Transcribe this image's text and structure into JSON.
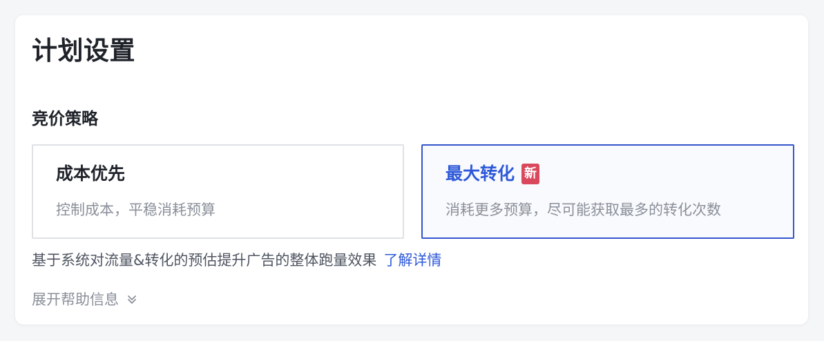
{
  "page": {
    "title": "计划设置"
  },
  "bidding": {
    "section_title": "竞价策略",
    "options": [
      {
        "title": "成本优先",
        "description": "控制成本，平稳消耗预算",
        "selected": false
      },
      {
        "title": "最大转化",
        "badge": "新",
        "description": "消耗更多预算，尽可能获取最多的转化次数",
        "selected": true
      }
    ],
    "explanation": "基于系统对流量&转化的预估提升广告的整体跑量效果",
    "learn_more_label": "了解详情"
  },
  "help": {
    "toggle_label": "展开帮助信息",
    "icon": "double-chevron-down-icon"
  },
  "colors": {
    "accent": "#2e59d9",
    "selected_border": "#3355cc",
    "badge": "#d9485c",
    "muted_text": "#8a8f99"
  }
}
